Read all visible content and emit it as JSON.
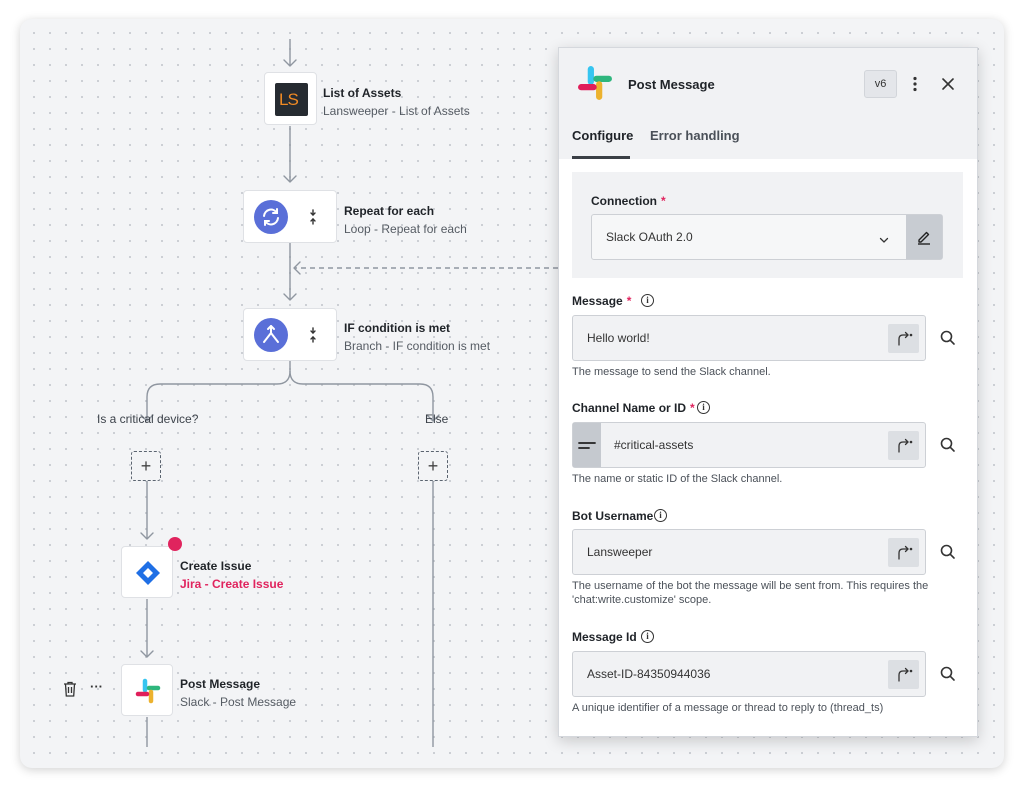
{
  "flow": {
    "nodes": {
      "list_assets": {
        "title": "List of Assets",
        "subtitle": "Lansweeper - List of Assets",
        "logo": "LS"
      },
      "repeat": {
        "title": "Repeat for each",
        "subtitle": "Loop - Repeat for each"
      },
      "if_condition": {
        "title": "IF condition is met",
        "subtitle": "Branch - IF condition is met"
      },
      "create_issue": {
        "title": "Create Issue",
        "subtitle": "Jira - Create Issue"
      },
      "post_message": {
        "title": "Post Message",
        "subtitle": "Slack - Post Message"
      }
    },
    "branches": {
      "left_label": "Is a critical device?",
      "right_label": "Else"
    },
    "plus_glyph": "+",
    "node_actions": {
      "delete_icon": "trash-icon",
      "more_glyph": "···"
    }
  },
  "panel": {
    "title": "Post Message",
    "version": "v6",
    "tabs": [
      {
        "label": "Configure",
        "active": true
      },
      {
        "label": "Error handling",
        "active": false
      }
    ],
    "connection": {
      "label": "Connection",
      "required": "*",
      "value": "Slack OAuth 2.0"
    },
    "fields": {
      "message": {
        "label": "Message",
        "required": "*",
        "value": "Hello world!",
        "help": "The message to send the Slack channel."
      },
      "channel": {
        "label": "Channel Name or ID",
        "required": "*",
        "value": "#critical-assets",
        "help": "The name or static ID of the Slack channel."
      },
      "bot_username": {
        "label": "Bot Username",
        "value": "Lansweeper",
        "help": "The username of the bot the message will be sent from. This requires the 'chat:write.customize' scope."
      },
      "message_id": {
        "label": "Message Id",
        "value": "Asset-ID-84350944036",
        "help": "A unique identifier of a message or thread to reply to (thread_ts)"
      }
    },
    "info_glyph": "i"
  },
  "colors": {
    "error_red": "#e0245e",
    "loop_blue": "#5a6fd8",
    "jira_blue": "#1f6fe5",
    "lansweeper_orange": "#f08a24"
  }
}
